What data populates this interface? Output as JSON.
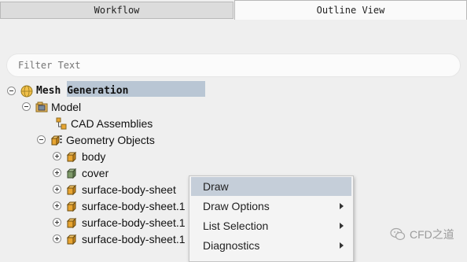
{
  "tabs": [
    {
      "label": "Workflow",
      "active": false
    },
    {
      "label": "Outline View",
      "active": true
    }
  ],
  "filter": {
    "placeholder": "Filter Text",
    "value": ""
  },
  "tree": {
    "root": {
      "label": "Mesh Generation",
      "icon": "globe-icon"
    },
    "model": {
      "label": "Model",
      "icon": "model-icon"
    },
    "cad": {
      "label": "CAD Assemblies",
      "icon": "cad-assemblies-icon"
    },
    "geometry": {
      "label": "Geometry Objects",
      "icon": "geometry-objects-icon"
    },
    "items": [
      {
        "label": "body",
        "selected": false
      },
      {
        "label": "cover",
        "selected": true
      },
      {
        "label": "surface-body-sheet",
        "selected": false
      },
      {
        "label": "surface-body-sheet.1",
        "selected": false
      },
      {
        "label": "surface-body-sheet.1",
        "selected": false
      },
      {
        "label": "surface-body-sheet.1",
        "selected": false
      }
    ]
  },
  "context_menu": {
    "items": [
      {
        "label": "Draw",
        "submenu": false,
        "highlighted": true
      },
      {
        "label": "Draw Options",
        "submenu": true,
        "highlighted": false
      },
      {
        "label": "List Selection",
        "submenu": true,
        "highlighted": false
      },
      {
        "label": "Diagnostics",
        "submenu": true,
        "highlighted": false
      }
    ]
  },
  "watermark": {
    "label": "CFD之道"
  },
  "colors": {
    "selection": "#b9c6d4",
    "menu_highlight": "#c5ced9",
    "cube_orange": "#e8a531"
  }
}
